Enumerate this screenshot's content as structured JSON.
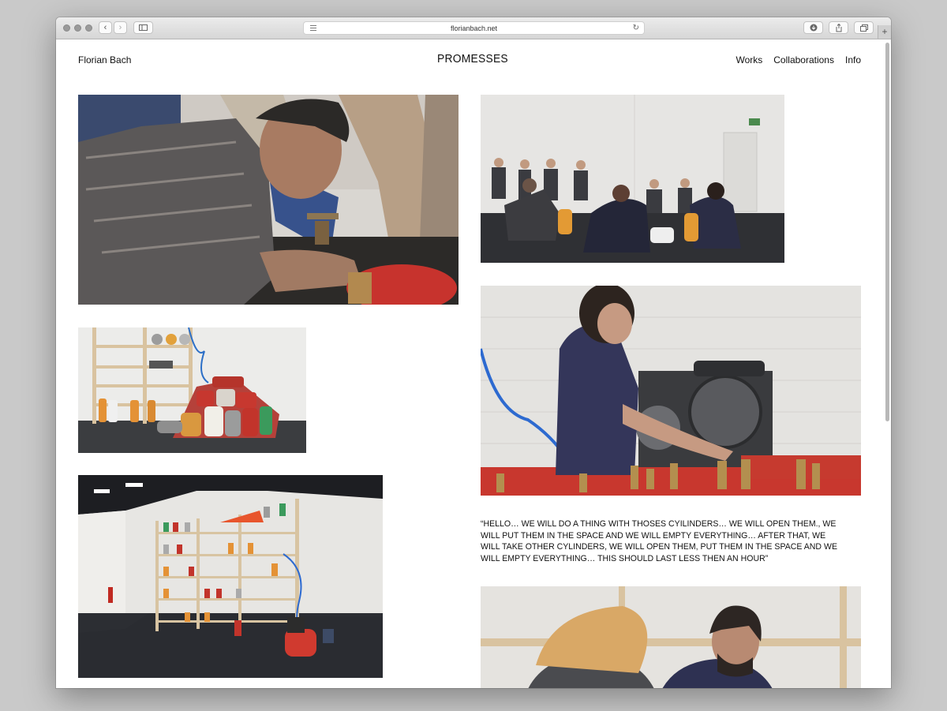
{
  "browser": {
    "url": "florianbach.net"
  },
  "site": {
    "name": "Florian Bach",
    "title": "PROMESSES",
    "nav": [
      "Works",
      "Collaborations",
      "Info"
    ]
  },
  "quote": "“HELLO… WE WILL DO A THING WITH THOSES CYILINDERS… WE WILL OPEN THEM., WE WILL PUT THEM IN THE SPACE AND WE WILL EMPTY EVERYTHING… AFTER THAT, WE WILL TAKE OTHER CYLINDERS, WE WILL OPEN THEM, PUT THEM IN THE SPACE AND WE WILL EMPTY EVERYTHING… THIS SHOULD LAST LESS THEN AN HOUR”",
  "colors": {
    "background": "#c9c9c9",
    "page": "#ffffff",
    "text": "#111111"
  },
  "icons": [
    "back-icon",
    "forward-icon",
    "sidebar-icon",
    "reader-icon",
    "reload-icon",
    "download-icon",
    "share-icon",
    "tabs-icon",
    "new-tab-icon"
  ]
}
